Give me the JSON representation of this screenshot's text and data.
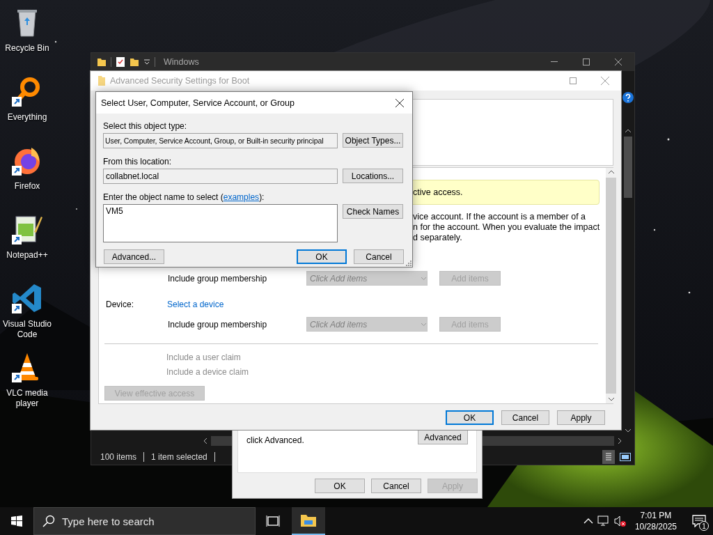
{
  "desktop_icons": [
    {
      "label": "Recycle Bin",
      "kind": "recycle",
      "shortcut": false
    },
    {
      "label": "Everything",
      "kind": "everything",
      "shortcut": true
    },
    {
      "label": "Firefox",
      "kind": "firefox",
      "shortcut": true
    },
    {
      "label": "Notepad++",
      "kind": "notepad",
      "shortcut": true
    },
    {
      "label": "Visual Studio Code",
      "kind": "vscode",
      "shortcut": true
    },
    {
      "label": "VLC media player",
      "kind": "vlc",
      "shortcut": true
    }
  ],
  "explorer": {
    "title": "Windows",
    "status_bar": [
      "100 items",
      "1 item selected"
    ]
  },
  "properties_window": {
    "text": "click Advanced.",
    "advanced_button": "Advanced",
    "buttons": [
      {
        "label": "OK",
        "disabled": false
      },
      {
        "label": "Cancel",
        "disabled": false
      },
      {
        "label": "Apply",
        "disabled": true
      }
    ]
  },
  "advanced_security": {
    "title": "Advanced Security Settings for Boot",
    "banner": "ctive access.",
    "description": [
      "vice account. If the account is a member of a",
      "n for the account. When you evaluate the impact",
      "d separately."
    ],
    "rows": [
      {
        "kind": "membership",
        "label": "Include group membership",
        "combo_text": "Click Add items",
        "button": "Add items",
        "disabled": true
      },
      {
        "kind": "device",
        "label": "Device:",
        "link": "Select a device"
      },
      {
        "kind": "membership",
        "label": "Include group membership",
        "combo_text": "Click Add items",
        "button": "Add items",
        "disabled": true
      }
    ],
    "claims": [
      {
        "label": "Include a user claim",
        "disabled": true
      },
      {
        "label": "Include a device claim",
        "disabled": true
      }
    ],
    "view_button": {
      "label": "View effective access",
      "disabled": true
    },
    "buttons": [
      {
        "label": "OK",
        "default": true
      },
      {
        "label": "Cancel",
        "default": false
      },
      {
        "label": "Apply",
        "default": false
      }
    ]
  },
  "select_dialog": {
    "title": "Select User, Computer, Service Account, or Group",
    "object_type_label": "Select this object type:",
    "object_type": "User, Computer, Service Account, Group, or Built-in security principal",
    "object_types_button": "Object Types...",
    "location_label": "From this location:",
    "location": "collabnet.local",
    "locations_button": "Locations...",
    "name_label_before": "Enter the object name to select (",
    "examples_link": "examples",
    "name_label_after": "):",
    "name_value": "VM5",
    "check_names_button": "Check Names",
    "advanced_button": "Advanced...",
    "buttons": [
      {
        "label": "OK",
        "default": true
      },
      {
        "label": "Cancel",
        "default": false
      }
    ]
  },
  "taskbar": {
    "search_placeholder": "Type here to search",
    "time": "7:01 PM",
    "date": "10/28/2025",
    "notification_count": "1"
  }
}
